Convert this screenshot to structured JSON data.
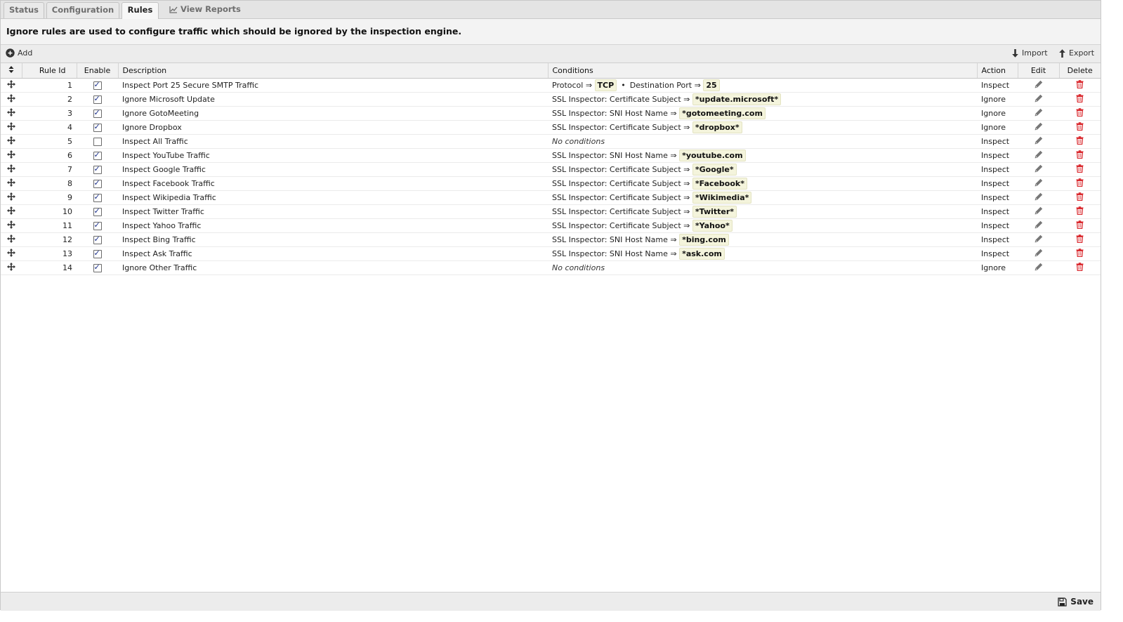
{
  "tabs": {
    "status": "Status",
    "configuration": "Configuration",
    "rules": "Rules",
    "view_reports": "View Reports"
  },
  "description": "Ignore rules are used to configure traffic which should be ignored by the inspection engine.",
  "toolbar": {
    "add": "Add",
    "import": "Import",
    "export": "Export"
  },
  "columns": {
    "rule_id": "Rule Id",
    "enable": "Enable",
    "description": "Description",
    "conditions": "Conditions",
    "action": "Action",
    "edit": "Edit",
    "delete": "Delete"
  },
  "arrow": "⇒",
  "bullet": "•",
  "no_conditions": "No conditions",
  "rules": [
    {
      "id": "1",
      "enabled": true,
      "description": "Inspect Port 25 Secure SMTP Traffic",
      "conditions": [
        {
          "label": "Protocol",
          "value": "TCP"
        },
        {
          "label": "Destination Port",
          "value": "25"
        }
      ],
      "action": "Inspect"
    },
    {
      "id": "2",
      "enabled": true,
      "description": "Ignore Microsoft Update",
      "conditions": [
        {
          "label": "SSL Inspector: Certificate Subject",
          "value": "*update.microsoft*"
        }
      ],
      "action": "Ignore"
    },
    {
      "id": "3",
      "enabled": true,
      "description": "Ignore GotoMeeting",
      "conditions": [
        {
          "label": "SSL Inspector: SNI Host Name",
          "value": "*gotomeeting.com"
        }
      ],
      "action": "Ignore"
    },
    {
      "id": "4",
      "enabled": true,
      "description": "Ignore Dropbox",
      "conditions": [
        {
          "label": "SSL Inspector: Certificate Subject",
          "value": "*dropbox*"
        }
      ],
      "action": "Ignore"
    },
    {
      "id": "5",
      "enabled": false,
      "description": "Inspect All Traffic",
      "conditions": [],
      "action": "Inspect"
    },
    {
      "id": "6",
      "enabled": true,
      "description": "Inspect YouTube Traffic",
      "conditions": [
        {
          "label": "SSL Inspector: SNI Host Name",
          "value": "*youtube.com"
        }
      ],
      "action": "Inspect"
    },
    {
      "id": "7",
      "enabled": true,
      "description": "Inspect Google Traffic",
      "conditions": [
        {
          "label": "SSL Inspector: Certificate Subject",
          "value": "*Google*"
        }
      ],
      "action": "Inspect"
    },
    {
      "id": "8",
      "enabled": true,
      "description": "Inspect Facebook Traffic",
      "conditions": [
        {
          "label": "SSL Inspector: Certificate Subject",
          "value": "*Facebook*"
        }
      ],
      "action": "Inspect"
    },
    {
      "id": "9",
      "enabled": true,
      "description": "Inspect Wikipedia Traffic",
      "conditions": [
        {
          "label": "SSL Inspector: Certificate Subject",
          "value": "*Wikimedia*"
        }
      ],
      "action": "Inspect"
    },
    {
      "id": "10",
      "enabled": true,
      "description": "Inspect Twitter Traffic",
      "conditions": [
        {
          "label": "SSL Inspector: Certificate Subject",
          "value": "*Twitter*"
        }
      ],
      "action": "Inspect"
    },
    {
      "id": "11",
      "enabled": true,
      "description": "Inspect Yahoo Traffic",
      "conditions": [
        {
          "label": "SSL Inspector: Certificate Subject",
          "value": "*Yahoo*"
        }
      ],
      "action": "Inspect"
    },
    {
      "id": "12",
      "enabled": true,
      "description": "Inspect Bing Traffic",
      "conditions": [
        {
          "label": "SSL Inspector: SNI Host Name",
          "value": "*bing.com"
        }
      ],
      "action": "Inspect"
    },
    {
      "id": "13",
      "enabled": true,
      "description": "Inspect Ask Traffic",
      "conditions": [
        {
          "label": "SSL Inspector: SNI Host Name",
          "value": "*ask.com"
        }
      ],
      "action": "Inspect"
    },
    {
      "id": "14",
      "enabled": true,
      "description": "Ignore Other Traffic",
      "conditions": [],
      "action": "Ignore"
    }
  ],
  "save": "Save",
  "colors": {
    "delete_icon": "#d9262b",
    "value_badge_bg": "#f4f4dc",
    "checkbox_check": "#1a2f8a"
  },
  "icons": {
    "reorder": "sort-arrows-icon",
    "drag": "move-arrows-icon",
    "edit": "pencil-icon",
    "delete": "trash-icon",
    "add": "plus-circle-icon",
    "import": "arrow-down-icon",
    "export": "arrow-up-icon",
    "save": "floppy-disk-icon",
    "reports": "line-chart-icon"
  }
}
